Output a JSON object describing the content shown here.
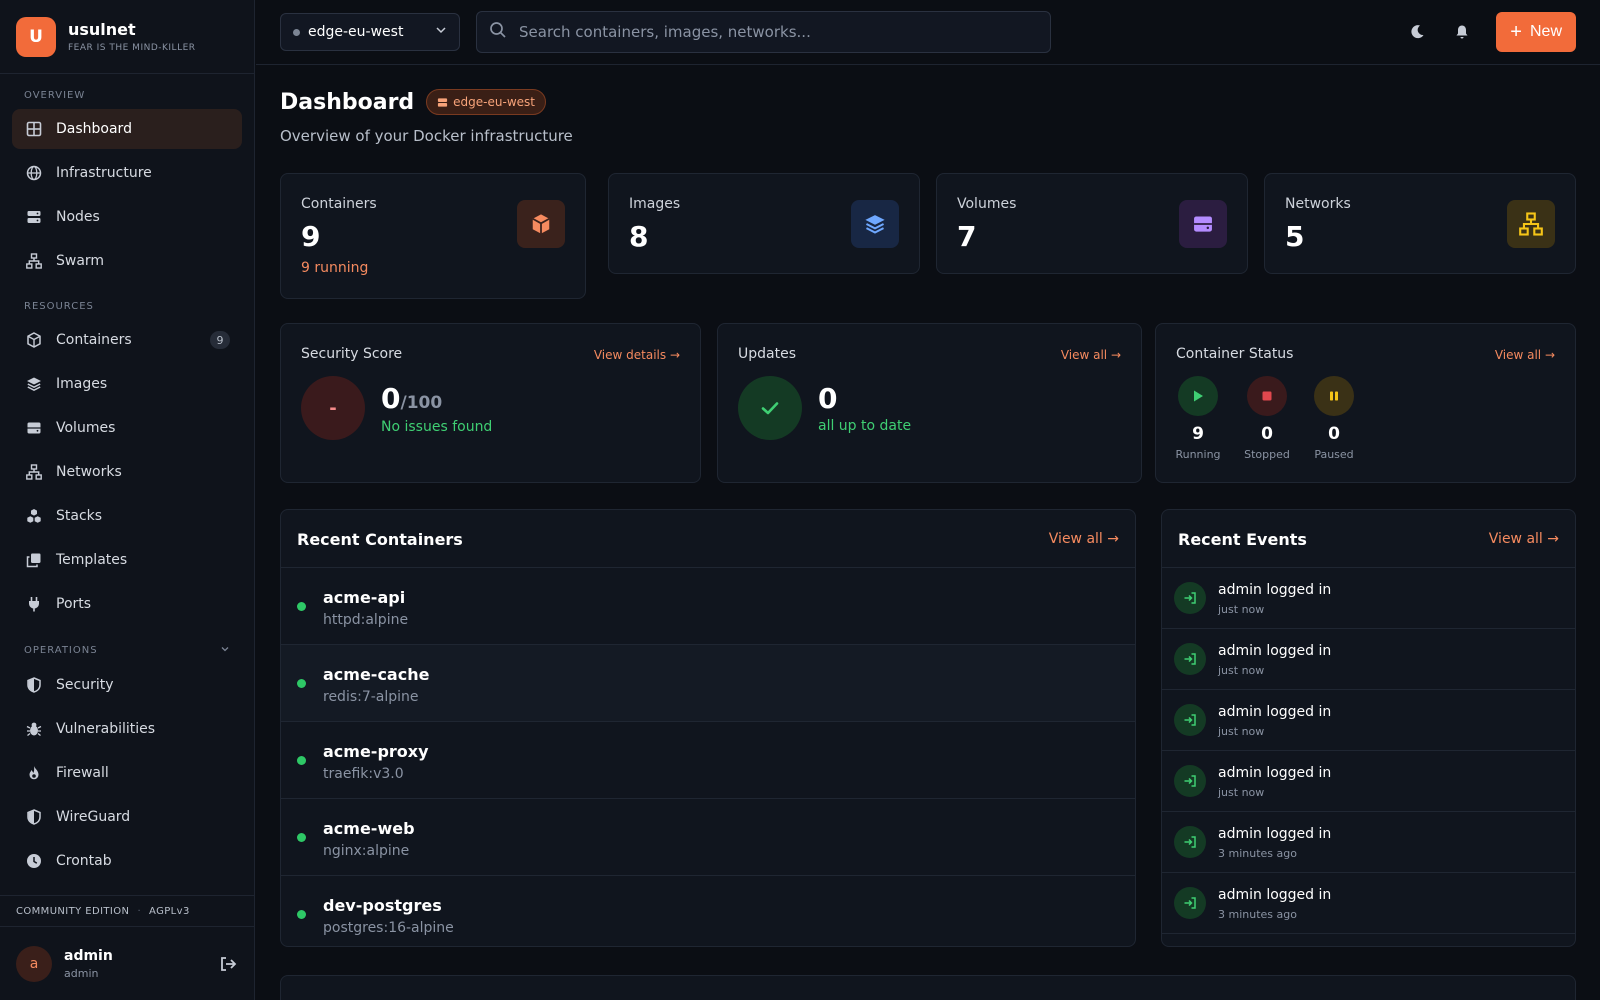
{
  "brand": {
    "logo_letter": "U",
    "name": "usulnet",
    "tagline": "FEAR IS THE MIND-KILLER"
  },
  "sidebar": {
    "sections": {
      "overview": "OVERVIEW",
      "resources": "RESOURCES",
      "operations": "OPERATIONS"
    },
    "overview_items": [
      {
        "label": "Dashboard",
        "icon": "grid-icon",
        "active": true
      },
      {
        "label": "Infrastructure",
        "icon": "globe-icon"
      },
      {
        "label": "Nodes",
        "icon": "server-icon"
      },
      {
        "label": "Swarm",
        "icon": "network-icon"
      }
    ],
    "resource_items": [
      {
        "label": "Containers",
        "icon": "cube-icon",
        "badge": "9"
      },
      {
        "label": "Images",
        "icon": "layers-icon"
      },
      {
        "label": "Volumes",
        "icon": "drive-icon"
      },
      {
        "label": "Networks",
        "icon": "network-icon"
      },
      {
        "label": "Stacks",
        "icon": "cubes-icon"
      },
      {
        "label": "Templates",
        "icon": "clone-icon"
      },
      {
        "label": "Ports",
        "icon": "plug-icon"
      }
    ],
    "operation_items": [
      {
        "label": "Security",
        "icon": "shield-icon"
      },
      {
        "label": "Vulnerabilities",
        "icon": "bug-icon"
      },
      {
        "label": "Firewall",
        "icon": "fire-icon"
      },
      {
        "label": "WireGuard",
        "icon": "shield-icon"
      },
      {
        "label": "Crontab",
        "icon": "clock-icon"
      }
    ],
    "edition": "COMMUNITY EDITION",
    "edition_sep": "·",
    "license": "AGPLv3"
  },
  "user": {
    "initial": "a",
    "name": "admin",
    "role": "admin"
  },
  "header": {
    "env": "edge-eu-west",
    "search_placeholder": "Search containers, images, networks...",
    "new_label": "New",
    "new_plus": "+"
  },
  "page": {
    "title": "Dashboard",
    "env_pill": "edge-eu-west",
    "subtitle": "Overview of your Docker infrastructure"
  },
  "stats": {
    "containers": {
      "label": "Containers",
      "value": "9",
      "sub": "9 running"
    },
    "images": {
      "label": "Images",
      "value": "8"
    },
    "volumes": {
      "label": "Volumes",
      "value": "7"
    },
    "networks": {
      "label": "Networks",
      "value": "5"
    }
  },
  "security": {
    "title": "Security Score",
    "link": "View details →",
    "grade": "-",
    "score": "0",
    "max": "/100",
    "note": "No issues found"
  },
  "updates": {
    "title": "Updates",
    "link": "View all →",
    "value": "0",
    "note": "all up to date"
  },
  "container_status": {
    "title": "Container Status",
    "link": "View all →",
    "running": {
      "value": "9",
      "label": "Running"
    },
    "stopped": {
      "value": "0",
      "label": "Stopped"
    },
    "paused": {
      "value": "0",
      "label": "Paused"
    }
  },
  "recent_containers": {
    "title": "Recent Containers",
    "link": "View all →",
    "rows": [
      {
        "name": "acme-api",
        "image": "httpd:alpine"
      },
      {
        "name": "acme-cache",
        "image": "redis:7-alpine"
      },
      {
        "name": "acme-proxy",
        "image": "traefik:v3.0"
      },
      {
        "name": "acme-web",
        "image": "nginx:alpine"
      },
      {
        "name": "dev-postgres",
        "image": "postgres:16-alpine"
      }
    ]
  },
  "recent_events": {
    "title": "Recent Events",
    "link": "View all →",
    "rows": [
      {
        "text": "admin logged in",
        "time": "just now"
      },
      {
        "text": "admin logged in",
        "time": "just now"
      },
      {
        "text": "admin logged in",
        "time": "just now"
      },
      {
        "text": "admin logged in",
        "time": "just now"
      },
      {
        "text": "admin logged in",
        "time": "3 minutes ago"
      },
      {
        "text": "admin logged in",
        "time": "3 minutes ago"
      }
    ]
  },
  "colors": {
    "accent": "#f26b3a",
    "success": "#2ec866",
    "danger": "#e0484e",
    "warning": "#f5c518"
  }
}
